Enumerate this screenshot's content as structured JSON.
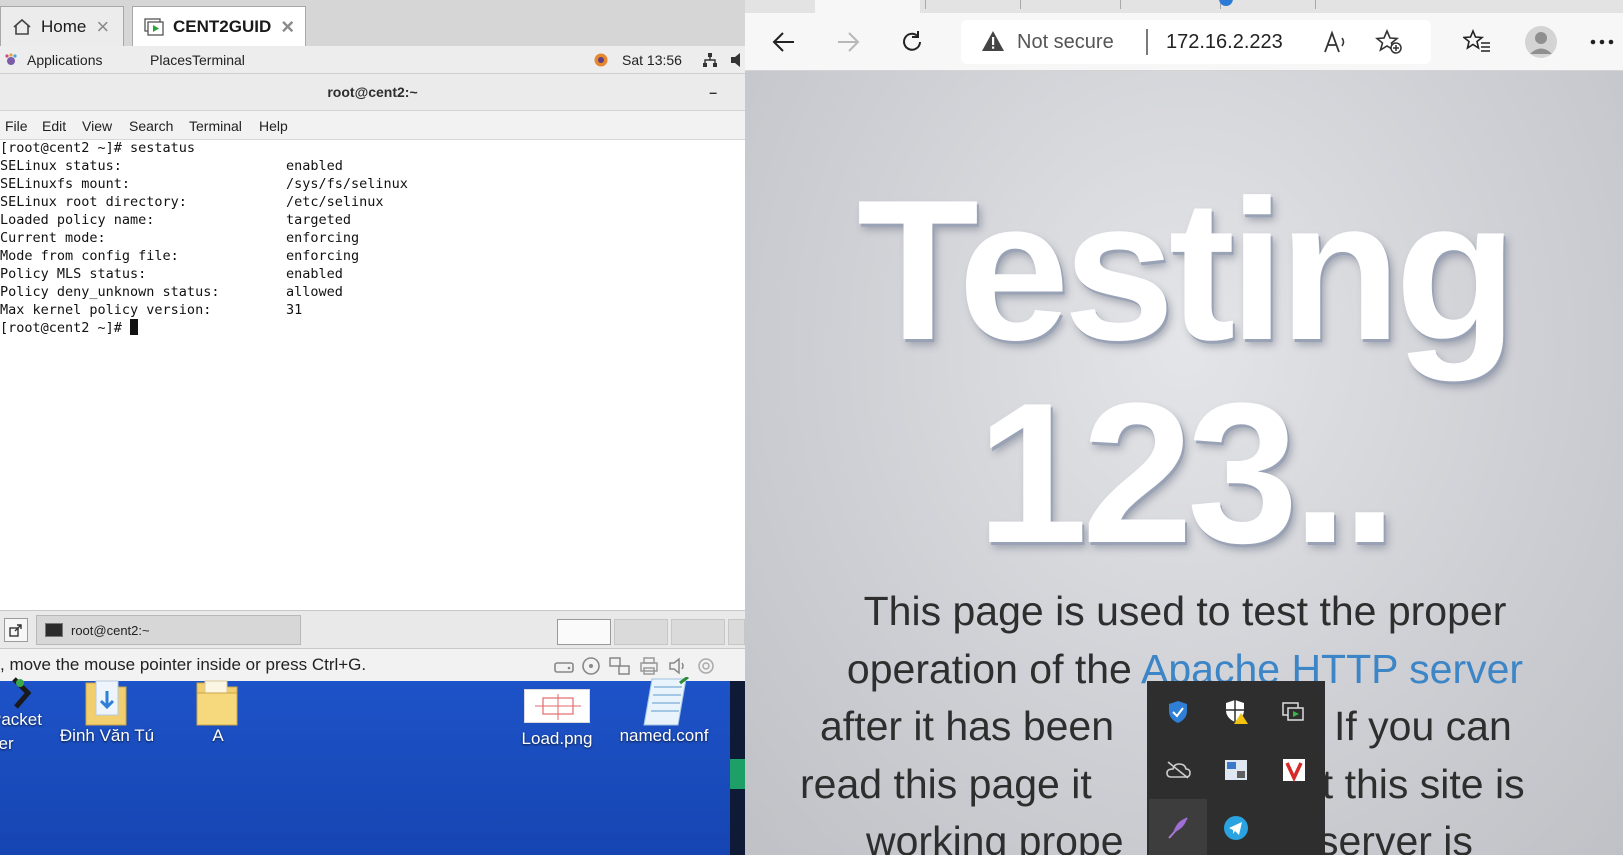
{
  "vmware": {
    "tabs": [
      {
        "label": "Home",
        "icon": "home-icon"
      },
      {
        "label": "CENT2GUID",
        "icon": "vm-icon"
      }
    ]
  },
  "gnome": {
    "applications": "Applications",
    "places": "Places",
    "terminal": "Terminal",
    "clock": "Sat 13:56"
  },
  "terminal": {
    "title": "root@cent2:~",
    "minimize": "–",
    "menu": [
      "File",
      "Edit",
      "View",
      "Search",
      "Terminal",
      "Help"
    ],
    "lines": [
      {
        "label": "[root@cent2 ~]# sestatus",
        "value": ""
      },
      {
        "label": "SELinux status:",
        "value": "enabled"
      },
      {
        "label": "SELinuxfs mount:",
        "value": "/sys/fs/selinux"
      },
      {
        "label": "SELinux root directory:",
        "value": "/etc/selinux"
      },
      {
        "label": "Loaded policy name:",
        "value": "targeted"
      },
      {
        "label": "Current mode:",
        "value": "enforcing"
      },
      {
        "label": "Mode from config file:",
        "value": "enforcing"
      },
      {
        "label": "Policy MLS status:",
        "value": "enabled"
      },
      {
        "label": "Policy deny_unknown status:",
        "value": "allowed"
      },
      {
        "label": "Max kernel policy version:",
        "value": "31"
      }
    ],
    "prompt": "[root@cent2 ~]# "
  },
  "taskbar": {
    "task": "root@cent2:~"
  },
  "vm_status": {
    "message": ", move the mouse pointer inside or press Ctrl+G."
  },
  "desktop": {
    "icons": [
      {
        "label": "Packet",
        "label2": "cer"
      },
      {
        "label": "Đinh Văn Tú"
      },
      {
        "label": "A"
      },
      {
        "label": "Load.png"
      },
      {
        "label": "named.conf"
      }
    ]
  },
  "browser": {
    "not_secure": "Not secure",
    "url": "172.16.2.223",
    "heading_line1": "Testing",
    "heading_line2": "123..",
    "para": {
      "t1": "This page is used to test the proper",
      "t2": "operation of the ",
      "link": "Apache HTTP server",
      "t3": "after it has been",
      "t4": "If you can",
      "t5": "read this page it",
      "t6": "at this site is",
      "t7": "working prope",
      "t8": "server is"
    }
  }
}
